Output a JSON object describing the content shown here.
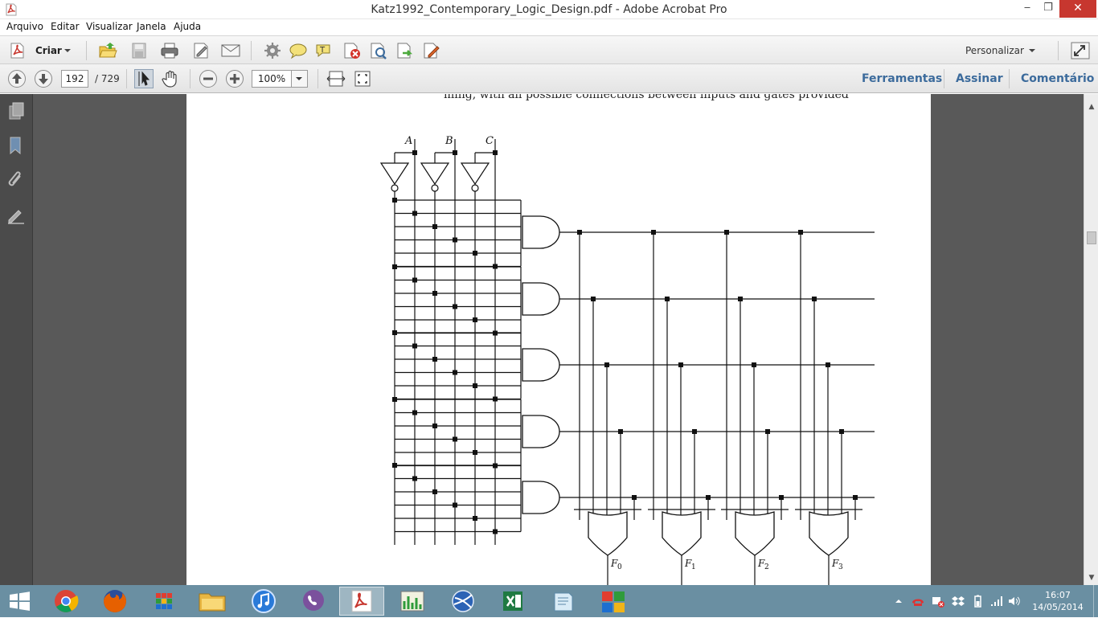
{
  "window": {
    "title": "Katz1992_Contemporary_Logic_Design.pdf - Adobe Acrobat Pro",
    "minimize": "‒",
    "restore": "❐",
    "close": "✕"
  },
  "menu": {
    "items": [
      {
        "label": "Arquivo"
      },
      {
        "label": "Editar"
      },
      {
        "label": "Visualizar"
      },
      {
        "label": "Janela"
      },
      {
        "label": "Ajuda"
      }
    ]
  },
  "toolbar1": {
    "criar_label": "Criar",
    "personalizar_label": "Personalizar",
    "icons": [
      "criar-icon",
      "open-icon",
      "save-icon",
      "print-icon",
      "sign-document-icon",
      "email-icon",
      "settings-icon",
      "comment-icon",
      "highlight-icon",
      "delete-page-icon",
      "search-document-icon",
      "export-icon",
      "edit-document-icon",
      "fullscreen-icon"
    ]
  },
  "toolbar2": {
    "page_current": "192",
    "page_total": "/ 729",
    "zoom": "100%",
    "links": {
      "ferramentas": "Ferramentas",
      "assinar": "Assinar",
      "comentario": "Comentário"
    }
  },
  "leftnav": {
    "icons": [
      "pages-icon",
      "bookmark-icon",
      "attachment-icon",
      "signature-icon"
    ]
  },
  "document": {
    "cut_text": "ming, with all possible connections between inputs and gates provided",
    "inputs": [
      "A",
      "B",
      "C"
    ],
    "outputs": [
      "F",
      "F",
      "F",
      "F"
    ],
    "output_subscripts": [
      "0",
      "1",
      "2",
      "3"
    ]
  },
  "taskbar": {
    "apps": [
      "chrome-icon",
      "firefox-icon",
      "apps-grid-icon",
      "file-explorer-icon",
      "itunes-icon",
      "viber-icon",
      "acrobat-icon",
      "equalizer-app-icon",
      "network-app-icon",
      "excel-icon",
      "notepad-icon",
      "windows-colors-icon"
    ],
    "active_app": "acrobat-icon",
    "time": "16:07",
    "date": "14/05/2014",
    "colors": {
      "taskbar": "#6a8fa2",
      "close": "#c7372f",
      "link": "#3c6b9c"
    }
  }
}
